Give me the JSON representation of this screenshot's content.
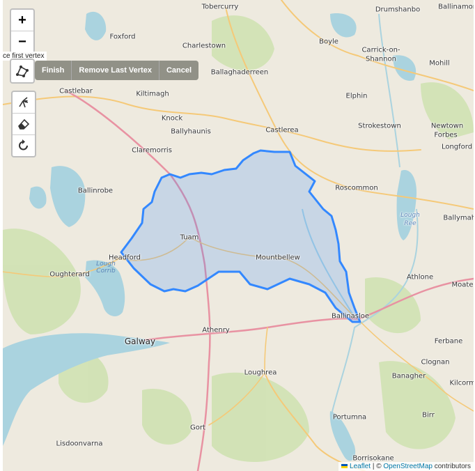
{
  "map": {
    "tooltip_text": "ce first vertex",
    "places": [
      {
        "name": "Tobercurry",
        "kind": "town"
      },
      {
        "name": "Drumshanbo",
        "kind": "town"
      },
      {
        "name": "Ballinamore",
        "kind": "town"
      },
      {
        "name": "Foxford",
        "kind": "town"
      },
      {
        "name": "Charlestown",
        "kind": "town"
      },
      {
        "name": "Boyle",
        "kind": "town"
      },
      {
        "name": "Carrick-on-",
        "kind": "town"
      },
      {
        "name": "Shannon",
        "kind": "town"
      },
      {
        "name": "Mohill",
        "kind": "town"
      },
      {
        "name": "Ballaghaderreen",
        "kind": "town"
      },
      {
        "name": "Castlebar",
        "kind": "town"
      },
      {
        "name": "Kiltimagh",
        "kind": "town"
      },
      {
        "name": "Elphin",
        "kind": "town"
      },
      {
        "name": "Knock",
        "kind": "town"
      },
      {
        "name": "Strokestown",
        "kind": "town"
      },
      {
        "name": "Newtown",
        "kind": "town"
      },
      {
        "name": "Forbes",
        "kind": "town"
      },
      {
        "name": "Ballyhaunis",
        "kind": "town"
      },
      {
        "name": "Castlerea",
        "kind": "town"
      },
      {
        "name": "Longford",
        "kind": "town"
      },
      {
        "name": "Claremorris",
        "kind": "town"
      },
      {
        "name": "Ballinrobe",
        "kind": "town"
      },
      {
        "name": "Roscommon",
        "kind": "town"
      },
      {
        "name": "Ballymahon",
        "kind": "town"
      },
      {
        "name": "Tuam",
        "kind": "town"
      },
      {
        "name": "Headford",
        "kind": "town"
      },
      {
        "name": "Mountbellew",
        "kind": "town"
      },
      {
        "name": "Oughterard",
        "kind": "town"
      },
      {
        "name": "Athlone",
        "kind": "town"
      },
      {
        "name": "Moate",
        "kind": "town"
      },
      {
        "name": "Ballinasloe",
        "kind": "town"
      },
      {
        "name": "Athenry",
        "kind": "town"
      },
      {
        "name": "Galway",
        "kind": "city"
      },
      {
        "name": "Ferbane",
        "kind": "town"
      },
      {
        "name": "Clognan",
        "kind": "town"
      },
      {
        "name": "Loughrea",
        "kind": "town"
      },
      {
        "name": "Banagher",
        "kind": "town"
      },
      {
        "name": "Kilcormac",
        "kind": "town"
      },
      {
        "name": "Gort",
        "kind": "town"
      },
      {
        "name": "Portumna",
        "kind": "town"
      },
      {
        "name": "Birr",
        "kind": "town"
      },
      {
        "name": "Lisdoonvarna",
        "kind": "town"
      },
      {
        "name": "Borrisokane",
        "kind": "town"
      },
      {
        "name": "Lough",
        "kind": "town"
      },
      {
        "name": "Ree",
        "kind": "town"
      },
      {
        "name": "Lough Corrib",
        "kind": "lake"
      }
    ]
  },
  "zoom": {
    "in_label": "+",
    "out_label": "−"
  },
  "draw_actions": {
    "finish": "Finish",
    "remove_last": "Remove Last Vertex",
    "cancel": "Cancel"
  },
  "attribution": {
    "leaflet": "Leaflet",
    "sep": " | © ",
    "osm": "OpenStreetMap",
    "contributors": " contributors"
  },
  "icons": [
    "zoom-in-icon",
    "zoom-out-icon",
    "draw-polygon-icon",
    "edit-layers-icon",
    "eraser-icon",
    "rotate-icon"
  ],
  "colors": {
    "polygon_stroke": "#3388ff",
    "polygon_fill": "#3388ff",
    "water": "#aad3df",
    "land": "#eeeadf",
    "forest": "#c8dfa8",
    "major_road": "#e892a2",
    "secondary_road": "#f5c978"
  }
}
